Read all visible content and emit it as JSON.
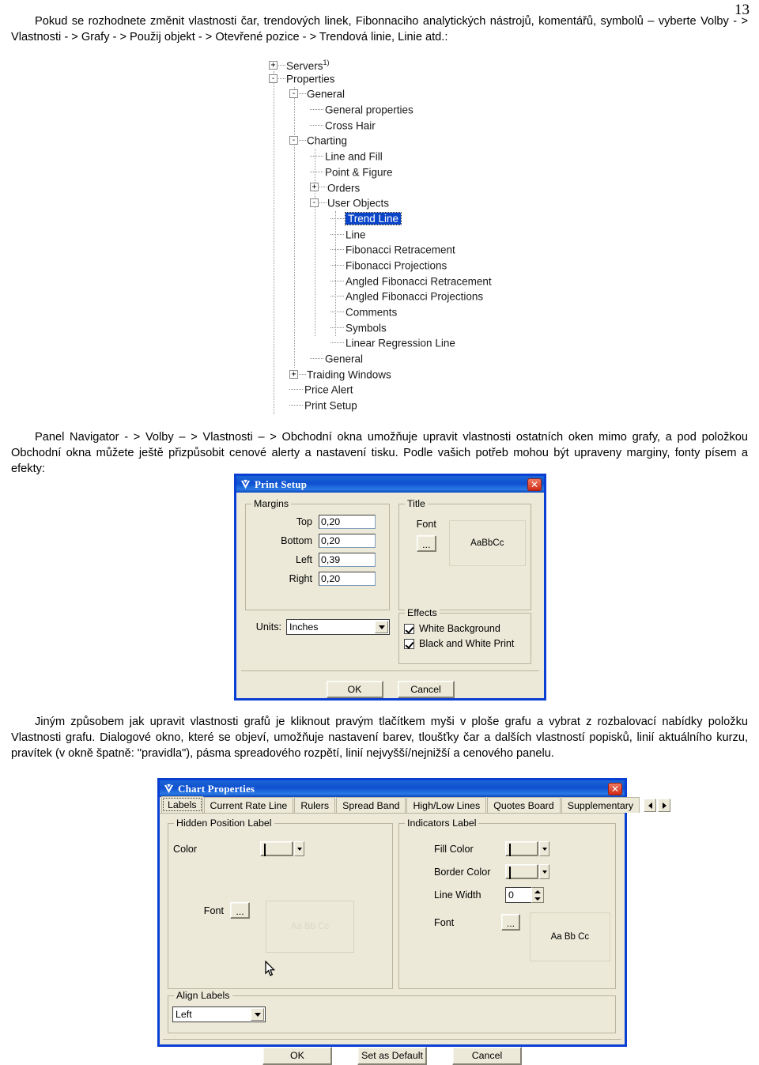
{
  "page": {
    "number": "13"
  },
  "paragraphs": {
    "intro": "Pokud se rozhodnete změnit vlastnosti čar, trendových linek, Fibonnaciho analytických nástrojů, komentářů, symbolů – vyberte Volby - >  Vlastnosti - > Grafy - > Použij objekt - > Otevřené pozice - > Trendová linie, Linie atd.:",
    "navigator": "Panel Navigator - > Volby – > Vlastnosti –  > Obchodní okna umožňuje upravit vlastnosti ostatních oken mimo grafy, a pod položkou Obchodní okna můžete ještě přizpůsobit cenové alerty a nastavení tisku. Podle vašich potřeb mohou být upraveny marginy, fonty písem a efekty:",
    "alternative": "Jiným způsobem jak upravit vlastnosti grafů je kliknout pravým tlačítkem myši v ploše grafu a vybrat z rozbalovací nabídky položku Vlastnosti grafu. Dialogové okno, které se objeví, umožňuje nastavení barev, tloušťky čar a dalších vlastností popisků, linií aktuálního kurzu, pravítek (v okně špatně: \"pravidla\"), pásma spreadového rozpětí, linií nejvyšší/nejnižší a cenového panelu."
  },
  "tree": {
    "nodes": [
      {
        "label": "Servers",
        "level": 0,
        "glyph": "+",
        "selected": false,
        "superscript": "1)"
      },
      {
        "label": "Properties",
        "level": 0,
        "glyph": "-",
        "selected": false
      },
      {
        "label": "General",
        "level": 1,
        "glyph": "-",
        "selected": false
      },
      {
        "label": "General properties",
        "level": 2,
        "glyph": "leaf",
        "selected": false
      },
      {
        "label": "Cross Hair",
        "level": 2,
        "glyph": "leaf",
        "selected": false
      },
      {
        "label": "Charting",
        "level": 1,
        "glyph": "-",
        "selected": false
      },
      {
        "label": "Line and Fill",
        "level": 2,
        "glyph": "leaf",
        "selected": false
      },
      {
        "label": "Point & Figure",
        "level": 2,
        "glyph": "leaf",
        "selected": false
      },
      {
        "label": "Orders",
        "level": 2,
        "glyph": "+",
        "selected": false
      },
      {
        "label": "User Objects",
        "level": 2,
        "glyph": "-",
        "selected": false
      },
      {
        "label": "Trend Line",
        "level": 3,
        "glyph": "leaf",
        "selected": true
      },
      {
        "label": "Line",
        "level": 3,
        "glyph": "leaf",
        "selected": false
      },
      {
        "label": "Fibonacci Retracement",
        "level": 3,
        "glyph": "leaf",
        "selected": false
      },
      {
        "label": "Fibonacci Projections",
        "level": 3,
        "glyph": "leaf",
        "selected": false
      },
      {
        "label": "Angled Fibonacci Retracement",
        "level": 3,
        "glyph": "leaf",
        "selected": false
      },
      {
        "label": "Angled Fibonacci Projections",
        "level": 3,
        "glyph": "leaf",
        "selected": false
      },
      {
        "label": "Comments",
        "level": 3,
        "glyph": "leaf",
        "selected": false
      },
      {
        "label": "Symbols",
        "level": 3,
        "glyph": "leaf",
        "selected": false
      },
      {
        "label": "Linear Regression Line",
        "level": 3,
        "glyph": "leaf",
        "selected": false
      },
      {
        "label": "General",
        "level": 2,
        "glyph": "leaf",
        "selected": false
      },
      {
        "label": "Traiding Windows",
        "level": 1,
        "glyph": "+",
        "selected": false
      },
      {
        "label": "Price Alert",
        "level": 1,
        "glyph": "leaf",
        "selected": false
      },
      {
        "label": "Print Setup",
        "level": 1,
        "glyph": "leaf",
        "selected": false
      }
    ]
  },
  "print_setup": {
    "title": "Print Setup",
    "close_label": "✕",
    "margins": {
      "legend": "Margins",
      "rows": [
        {
          "label": "Top",
          "value": "0,20"
        },
        {
          "label": "Bottom",
          "value": "0,20"
        },
        {
          "label": "Left",
          "value": "0,39"
        },
        {
          "label": "Right",
          "value": "0,20"
        }
      ]
    },
    "units": {
      "label": "Units:",
      "value": "Inches"
    },
    "title_group": {
      "legend": "Title",
      "font_label": "Font",
      "font_button": "...",
      "preview": "AaBbCc"
    },
    "effects": {
      "legend": "Effects",
      "items": [
        {
          "label": "White Background",
          "checked": true
        },
        {
          "label": "Black and White Print",
          "checked": true
        }
      ]
    },
    "buttons": {
      "ok": "OK",
      "cancel": "Cancel"
    }
  },
  "chart_properties": {
    "title": "Chart Properties",
    "close_label": "✕",
    "tabs": [
      {
        "label": "Labels",
        "active": true
      },
      {
        "label": "Current Rate Line",
        "active": false
      },
      {
        "label": "Rulers",
        "active": false
      },
      {
        "label": "Spread Band",
        "active": false
      },
      {
        "label": "High/Low Lines",
        "active": false
      },
      {
        "label": "Quotes Board",
        "active": false
      },
      {
        "label": "Supplementary",
        "active": false
      }
    ],
    "hidden_position_label": {
      "legend": "Hidden Position Label",
      "color_label": "Color",
      "color_value": "#0a16d2",
      "font_label": "Font",
      "font_button": "...",
      "preview": "Aa Bb Cc"
    },
    "indicators_label": {
      "legend": "Indicators Label",
      "fill_color_label": "Fill Color",
      "fill_color_value": "#ffffff",
      "border_color_label": "Border Color",
      "border_color_value": "#ffffff",
      "line_width_label": "Line Width",
      "line_width_value": "0",
      "font_label": "Font",
      "font_button": "...",
      "preview": "Aa Bb Cc"
    },
    "align_labels": {
      "legend": "Align Labels",
      "value": "Left"
    },
    "buttons": {
      "ok": "OK",
      "set_default": "Set as Default",
      "cancel": "Cancel"
    }
  }
}
